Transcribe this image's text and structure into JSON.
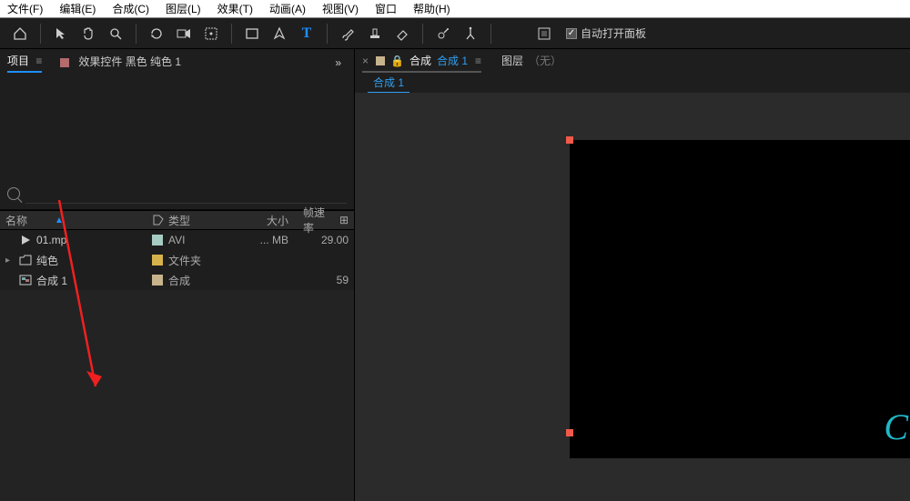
{
  "menu": {
    "file": "文件(F)",
    "edit": "编辑(E)",
    "comp": "合成(C)",
    "layer": "图层(L)",
    "effect": "效果(T)",
    "anim": "动画(A)",
    "view": "视图(V)",
    "window": "窗口",
    "help": "帮助(H)"
  },
  "toolbar": {
    "auto_open": "自动打开面板"
  },
  "left_tabs": {
    "project": "项目",
    "menu_glyph": "≡",
    "fx_controls": "效果控件 黑色 纯色 1",
    "chev": "»"
  },
  "search": {
    "placeholder": ""
  },
  "proj_cols": {
    "name": "名称",
    "type": "类型",
    "size": "大小",
    "fps": "帧速率"
  },
  "proj_rows": [
    {
      "name": "01.mp",
      "type": "AVI",
      "size": "... MB",
      "fps": "29.00",
      "label": "#a7ccc3",
      "icon": "video"
    },
    {
      "name": "纯色",
      "type": "文件夹",
      "size": "",
      "fps": "",
      "label": "#d6b24c",
      "icon": "folder",
      "expandable": true
    },
    {
      "name": "合成 1",
      "type": "合成",
      "size": "",
      "fps": "59",
      "label": "#c8b48c",
      "icon": "comp"
    }
  ],
  "comp": {
    "label": "合成",
    "title": "合成 1",
    "layer_label": "图层",
    "layer_none": "（无）",
    "flow": "合成 1"
  },
  "cursive": "C"
}
